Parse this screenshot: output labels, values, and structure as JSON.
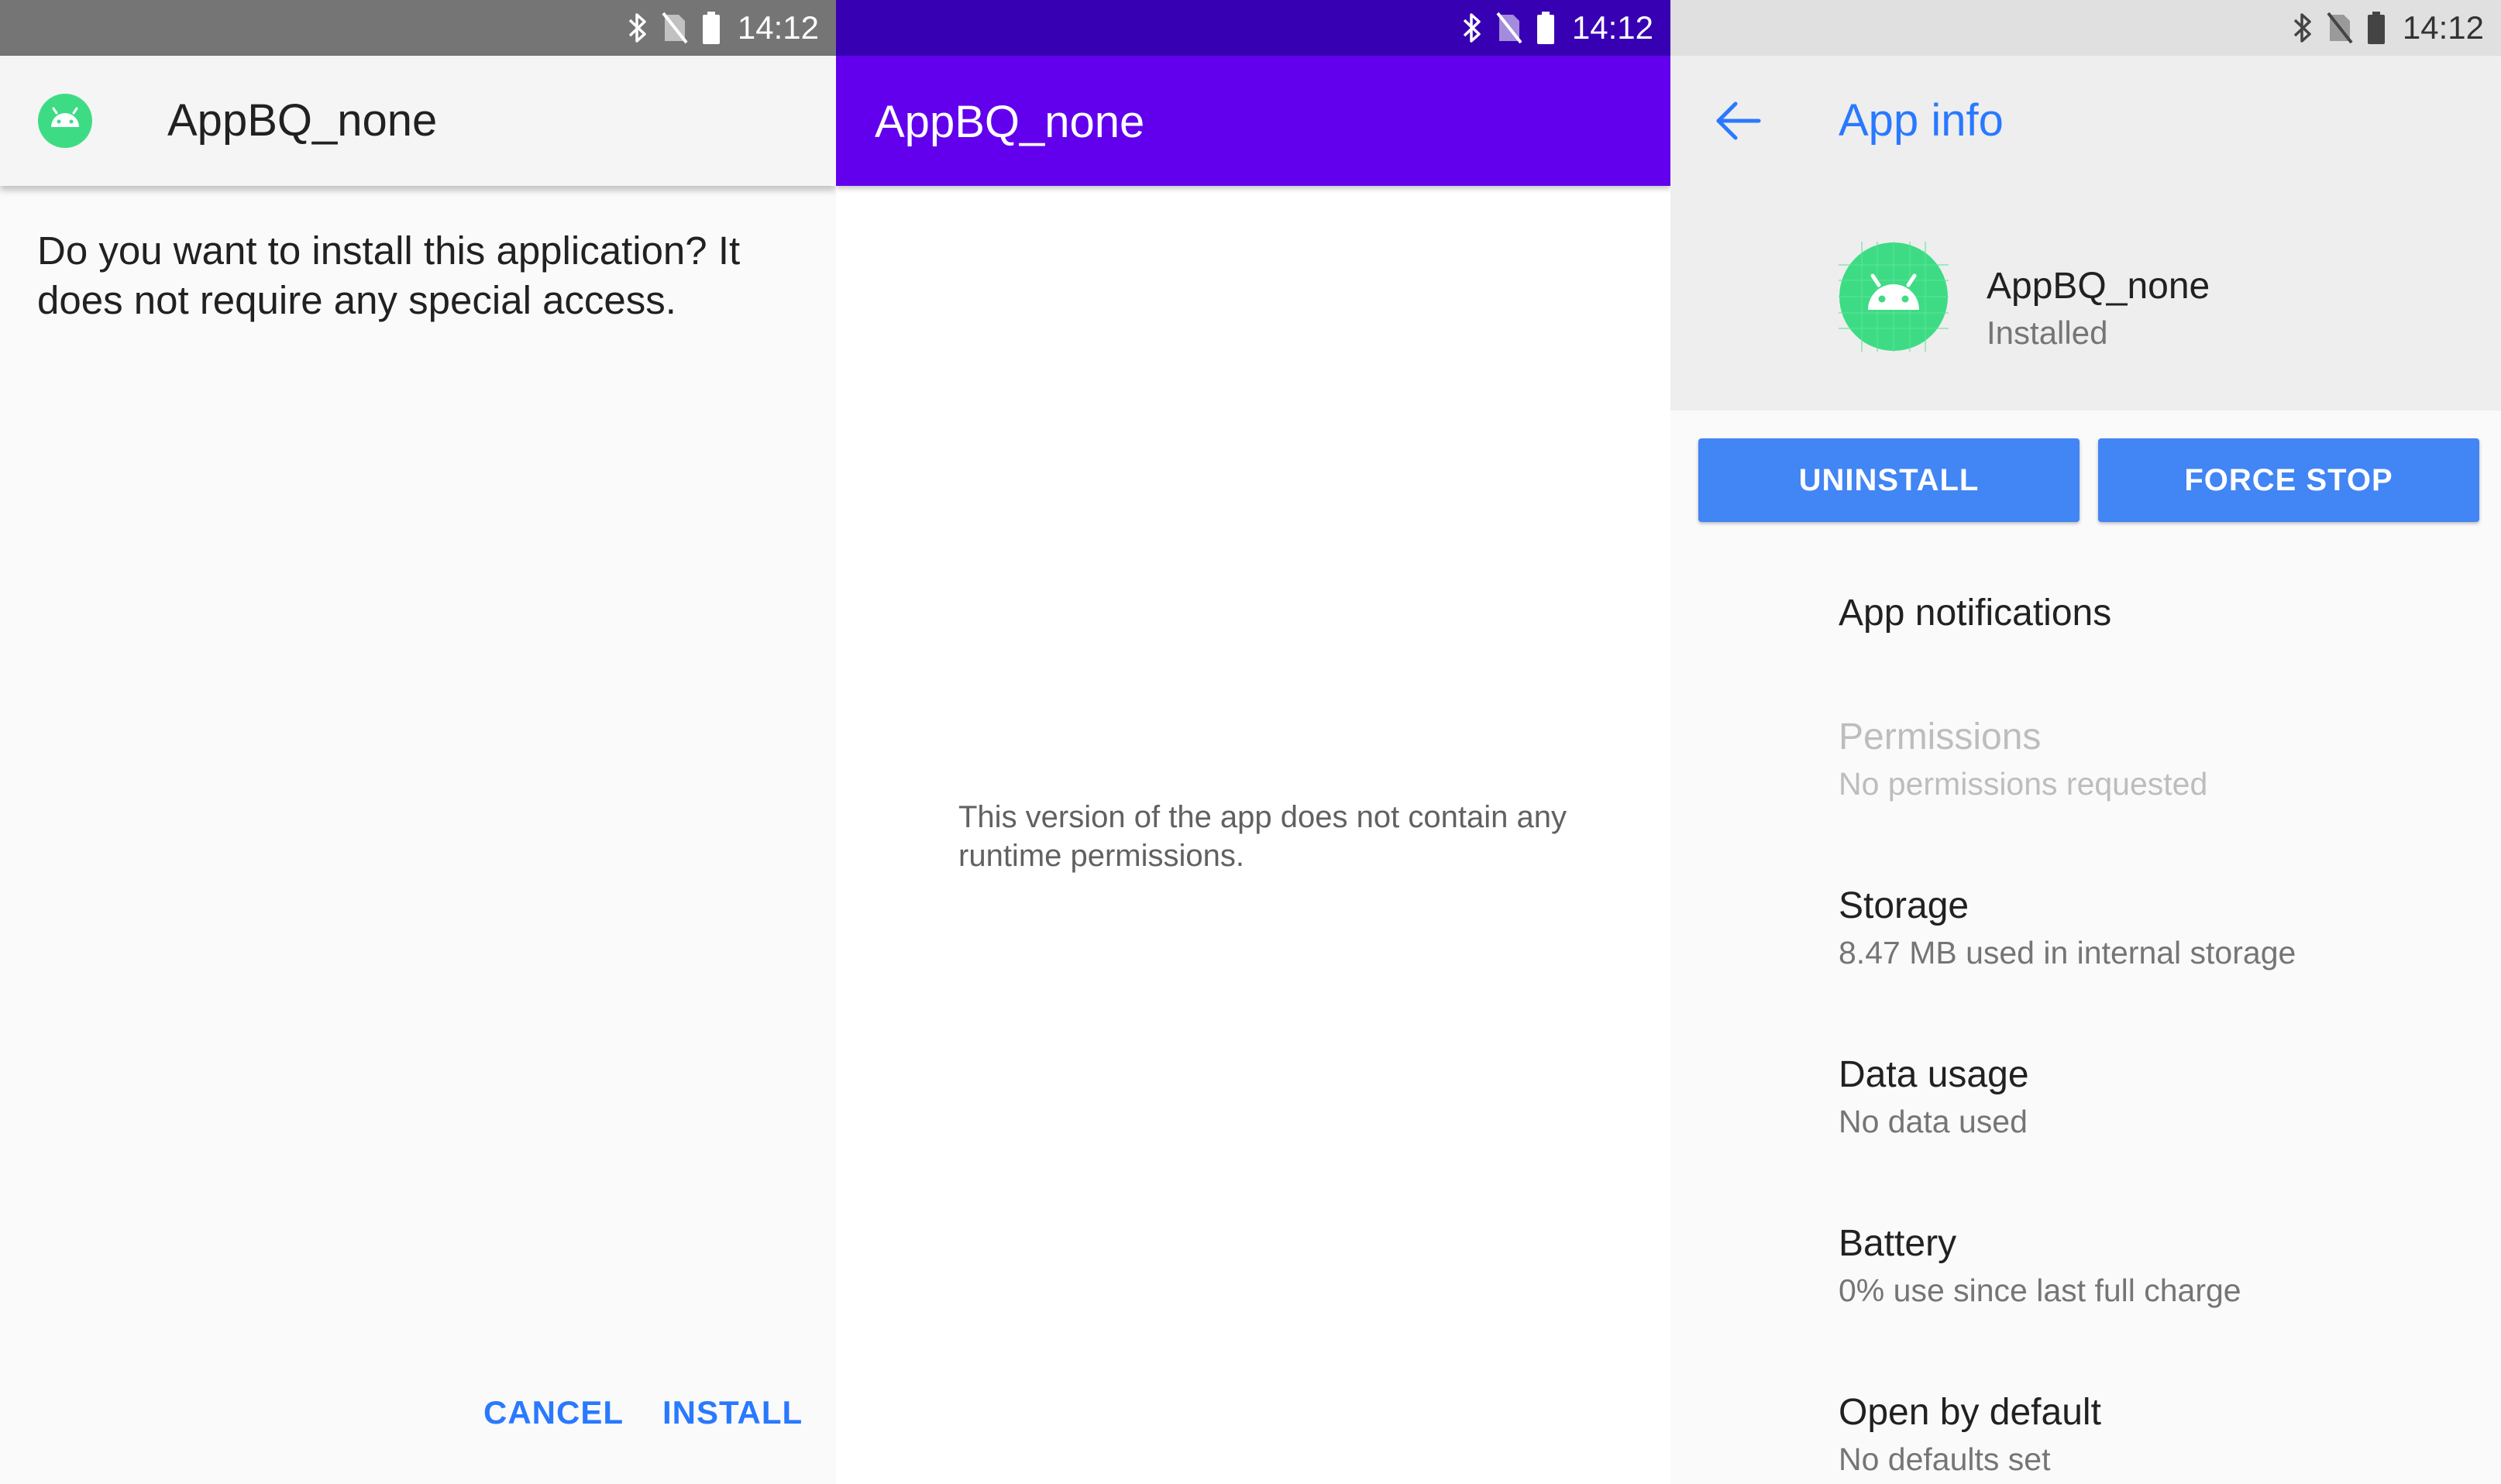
{
  "status_bar": {
    "time": "14:12"
  },
  "install_dialog": {
    "app_name": "AppBQ_none",
    "message": "Do you want to install this application? It does not require any special access.",
    "cancel_label": "CANCEL",
    "install_label": "INSTALL"
  },
  "permissions_screen": {
    "title": "AppBQ_none",
    "message": "This version of the app does not contain any runtime permissions."
  },
  "app_info": {
    "title": "App info",
    "app_name": "AppBQ_none",
    "app_status": "Installed",
    "uninstall_label": "UNINSTALL",
    "force_stop_label": "FORCE STOP",
    "items": [
      {
        "title": "App notifications",
        "subtitle": ""
      },
      {
        "title": "Permissions",
        "subtitle": "No permissions requested",
        "disabled": true
      },
      {
        "title": "Storage",
        "subtitle": "8.47 MB used in internal storage"
      },
      {
        "title": "Data usage",
        "subtitle": "No data used"
      },
      {
        "title": "Battery",
        "subtitle": "0% use since last full charge"
      },
      {
        "title": "Open by default",
        "subtitle": "No defaults set"
      }
    ]
  },
  "colors": {
    "accent": "#2979ff",
    "purple_toolbar": "#6200ee",
    "purple_status": "#3700b3",
    "button_blue": "#4285f4",
    "android_green": "#3ddc84"
  }
}
